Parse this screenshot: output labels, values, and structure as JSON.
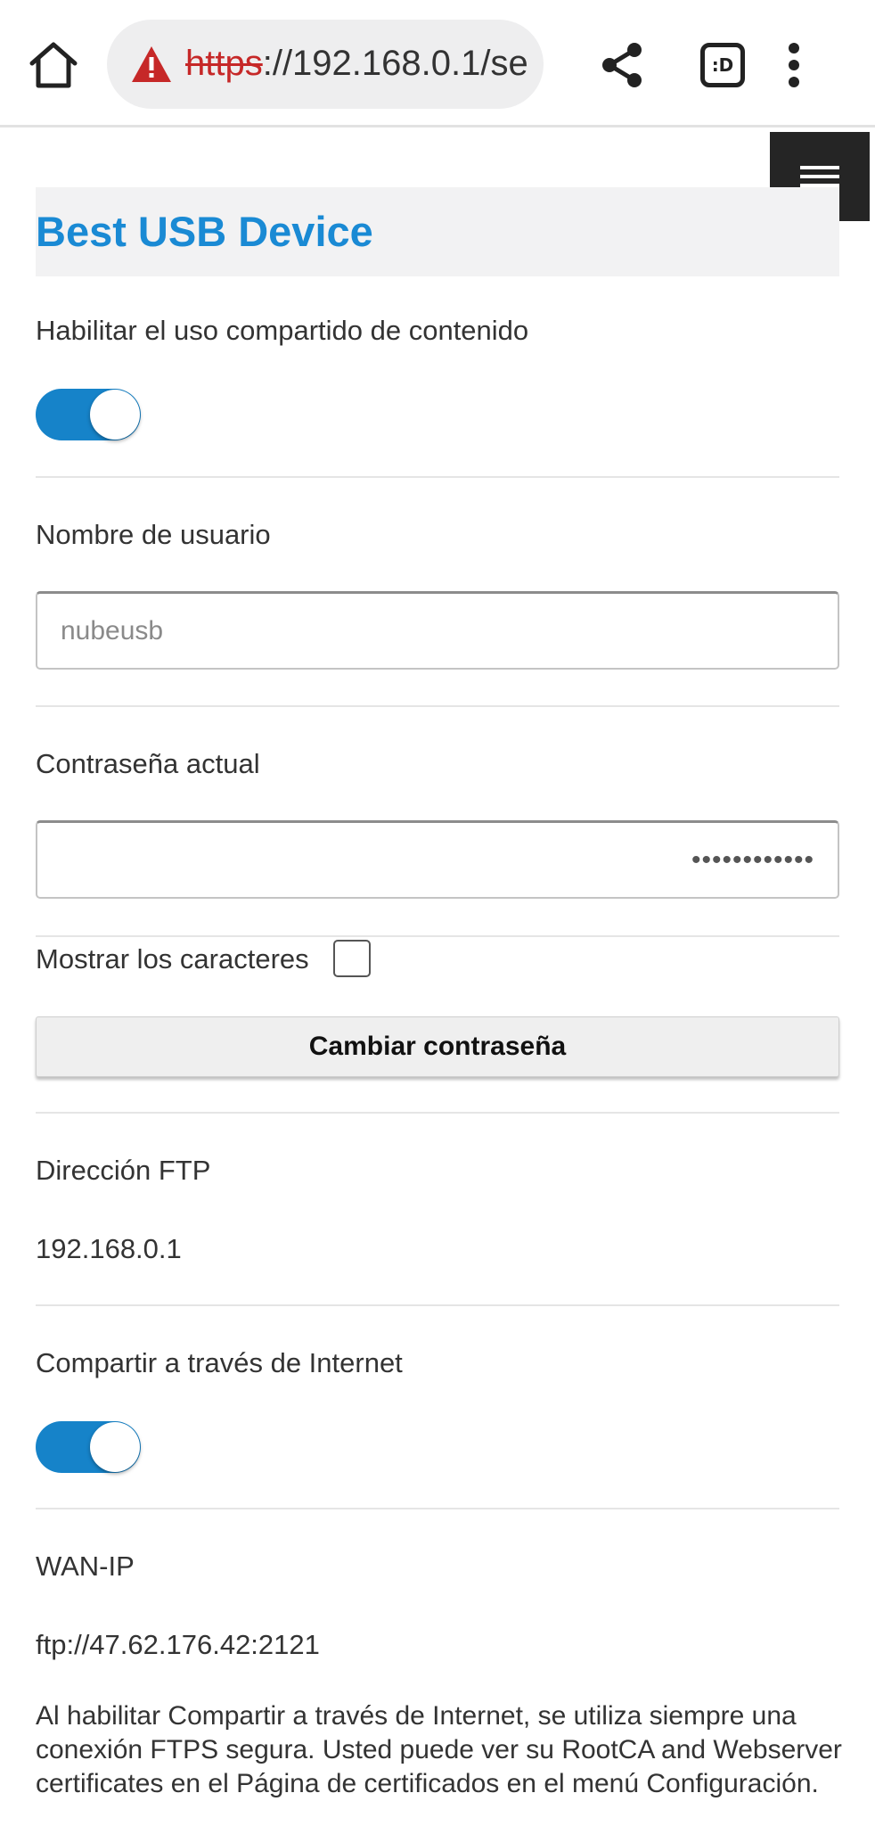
{
  "browser": {
    "url_scheme": "https",
    "url_rest": "://192.168.0.1/se",
    "tabs_label": ":D"
  },
  "page": {
    "title": "Best USB Device",
    "content_sharing": {
      "label": "Habilitar el uso compartido de contenido",
      "enabled": true
    },
    "username": {
      "label": "Nombre de usuario",
      "placeholder": "nubeusb"
    },
    "password": {
      "label": "Contraseña actual",
      "value": "••••••••••••"
    },
    "show_chars": {
      "label": "Mostrar los caracteres",
      "checked": false
    },
    "change_password_label": "Cambiar contraseña",
    "ftp": {
      "label": "Dirección FTP",
      "value": "192.168.0.1"
    },
    "internet_sharing": {
      "label": "Compartir a través de Internet",
      "enabled": true
    },
    "wan_ip": {
      "label": "WAN-IP",
      "value": "ftp://47.62.176.42:2121"
    },
    "info": "Al habilitar Compartir a través de Internet, se utiliza siempre una conexión FTPS segura. Usted puede ver su RootCA and Webserver certificates en el Página de certificados en el menú Configuración."
  },
  "colors": {
    "accent": "#1683c9",
    "title": "#1a8ad4",
    "warning": "#c62828"
  }
}
